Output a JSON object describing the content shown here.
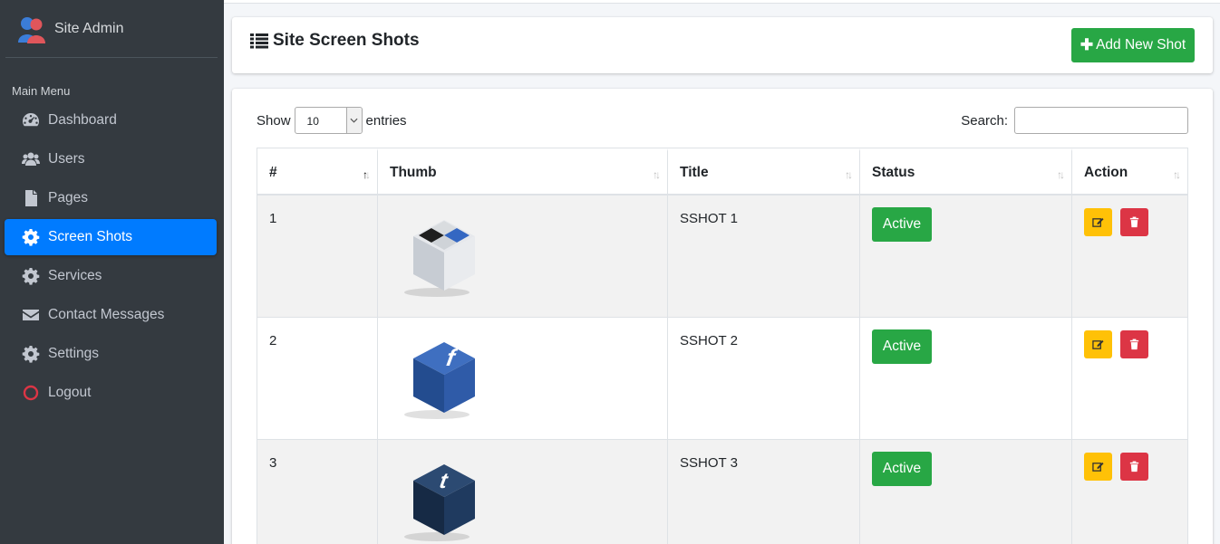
{
  "sidebar": {
    "brand": "Site Admin",
    "menu_header": "Main Menu",
    "items": [
      {
        "label": "Dashboard",
        "icon": "tachometer-icon"
      },
      {
        "label": "Users",
        "icon": "users-icon"
      },
      {
        "label": "Pages",
        "icon": "file-icon"
      },
      {
        "label": "Screen Shots",
        "icon": "gear-icon",
        "active": true
      },
      {
        "label": "Services",
        "icon": "gear-icon"
      },
      {
        "label": "Contact Messages",
        "icon": "envelope-icon"
      },
      {
        "label": "Settings",
        "icon": "gear-icon"
      },
      {
        "label": "Logout",
        "icon": "power-icon"
      }
    ]
  },
  "header": {
    "title": "Site Screen Shots",
    "add_button": "Add New Shot"
  },
  "table_controls": {
    "show_label": "Show",
    "entries_value": "10",
    "entries_label": "entries",
    "search_label": "Search:"
  },
  "table": {
    "columns": [
      "#",
      "Thumb",
      "Title",
      "Status",
      "Action"
    ],
    "rows": [
      {
        "num": "1",
        "title": "SSHOT 1",
        "status": "Active",
        "thumb": "box-logo"
      },
      {
        "num": "2",
        "title": "SSHOT 2",
        "status": "Active",
        "thumb": "facebook-cube"
      },
      {
        "num": "3",
        "title": "SSHOT 3",
        "status": "Active",
        "thumb": "tumblr-cube"
      }
    ]
  },
  "colors": {
    "sidebar_bg": "#343a40",
    "active_nav": "#007bff",
    "success": "#28a745",
    "warning": "#ffc107",
    "danger": "#dc3545",
    "logout_icon": "#dc3545"
  }
}
